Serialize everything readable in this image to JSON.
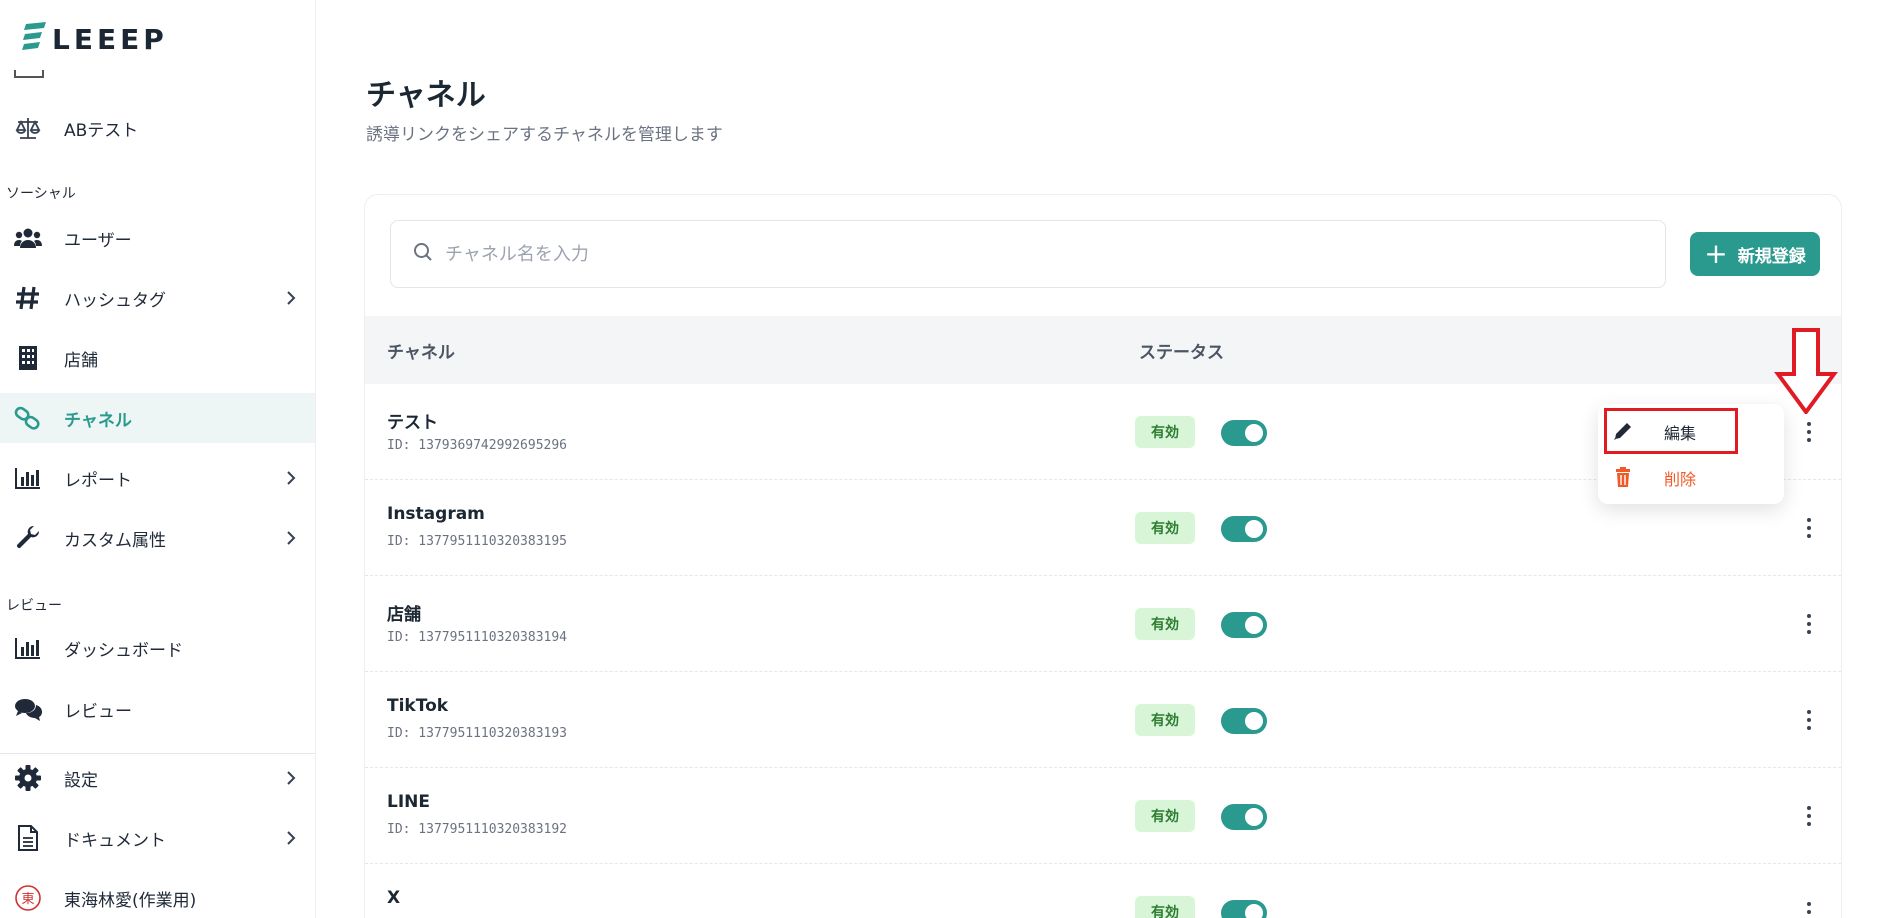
{
  "brand": {
    "name": "LEEEP"
  },
  "sidebar": {
    "items_top": [
      {
        "label": "ABテスト",
        "icon": "scale-icon"
      }
    ],
    "section_social": "ソーシャル",
    "social": [
      {
        "label": "ユーザー",
        "icon": "users-icon"
      },
      {
        "label": "ハッシュタグ",
        "icon": "hashtag-icon"
      },
      {
        "label": "店舗",
        "icon": "building-icon"
      },
      {
        "label": "チャネル",
        "icon": "link-icon",
        "active": true
      },
      {
        "label": "レポート",
        "icon": "chart-bar-icon"
      },
      {
        "label": "カスタム属性",
        "icon": "wrench-icon"
      }
    ],
    "section_review": "レビュー",
    "review": [
      {
        "label": "ダッシュボード",
        "icon": "chart-bar-icon"
      },
      {
        "label": "レビュー",
        "icon": "comments-icon"
      }
    ],
    "bottom": [
      {
        "label": "設定",
        "icon": "gear-icon"
      },
      {
        "label": "ドキュメント",
        "icon": "document-icon"
      }
    ],
    "user": {
      "label": "東海林愛(作業用)",
      "avatar_char": "東"
    }
  },
  "page": {
    "title": "チャネル",
    "subtitle": "誘導リンクをシェアするチャネルを管理します"
  },
  "search": {
    "placeholder": "チャネル名を入力",
    "value": ""
  },
  "new_button": {
    "label": "新規登録"
  },
  "table": {
    "headers": [
      "チャネル",
      "ステータス"
    ],
    "rows": [
      {
        "name": "テスト",
        "id": "ID: 1379369742992695296",
        "status": "有効"
      },
      {
        "name": "Instagram",
        "id": "ID: 1377951110320383195",
        "status": "有効"
      },
      {
        "name": "店舗",
        "id": "ID: 1377951110320383194",
        "status": "有効"
      },
      {
        "name": "TikTok",
        "id": "ID: 1377951110320383193",
        "status": "有効"
      },
      {
        "name": "LINE",
        "id": "ID: 1377951110320383192",
        "status": "有効"
      },
      {
        "name": "X",
        "id": "",
        "status": "有効"
      }
    ]
  },
  "row_menu": {
    "edit": "編集",
    "delete": "削除"
  },
  "colors": {
    "accent": "#2a9a8e",
    "danger": "#f05a28",
    "annotation": "#e01b24"
  }
}
